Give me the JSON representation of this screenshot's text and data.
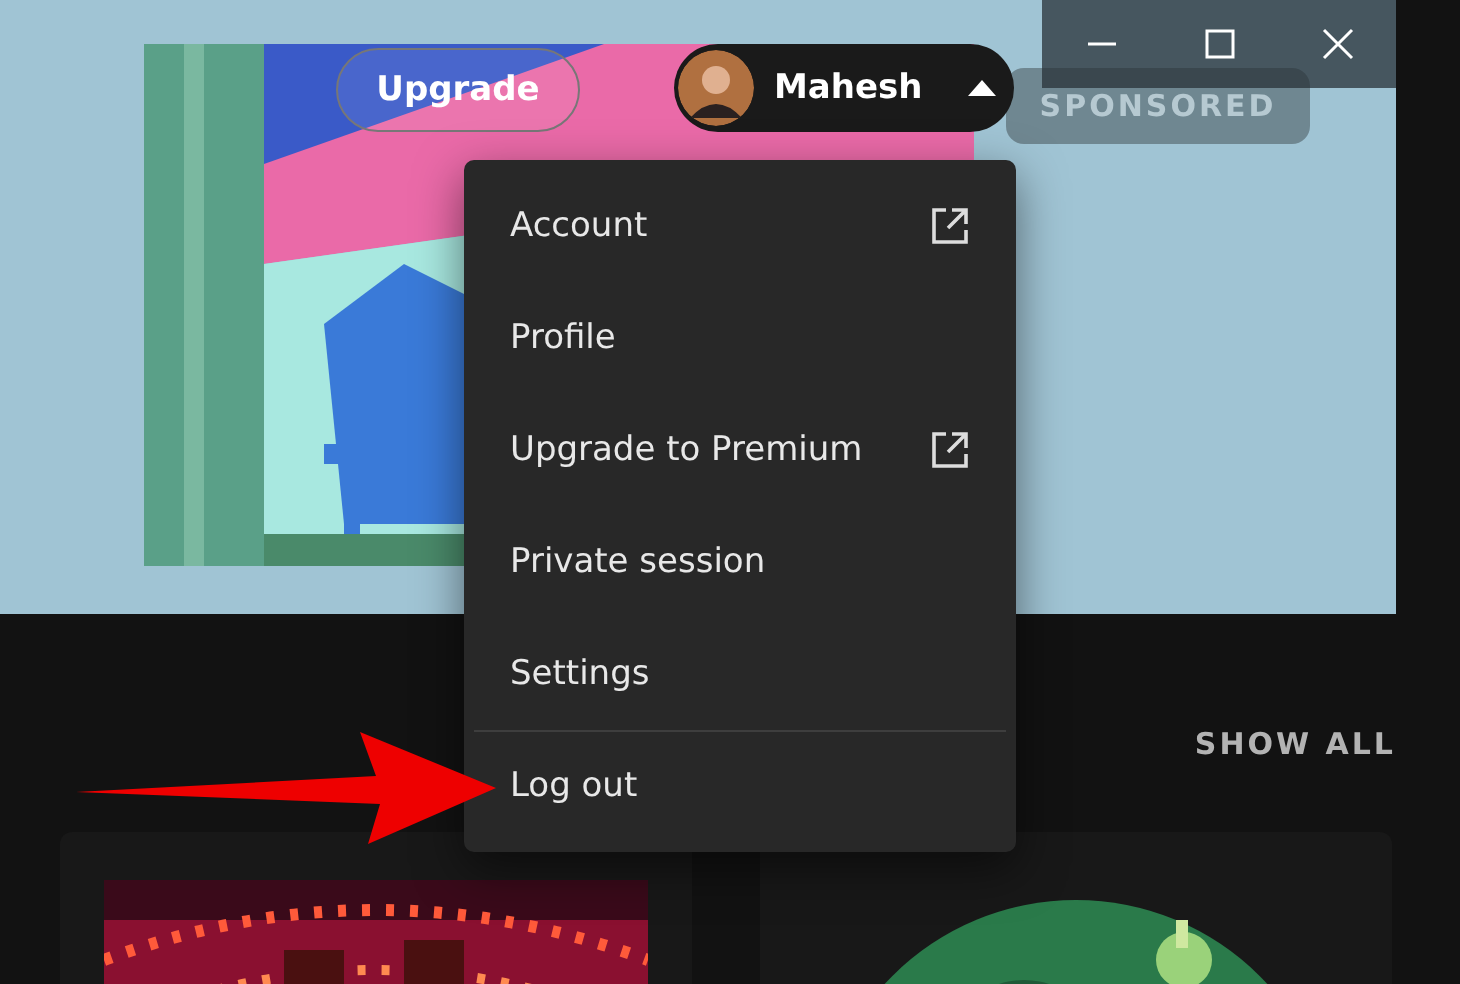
{
  "header": {
    "upgrade_button": "Upgrade",
    "user": {
      "name": "Mahesh",
      "menu_open": true
    },
    "ad_badge": "SPONSORED"
  },
  "menu": [
    {
      "label": "Account",
      "external": true,
      "separated": false
    },
    {
      "label": "Profile",
      "external": false,
      "separated": false
    },
    {
      "label": "Upgrade to Premium",
      "external": true,
      "separated": false
    },
    {
      "label": "Private session",
      "external": false,
      "separated": false
    },
    {
      "label": "Settings",
      "external": false,
      "separated": false
    },
    {
      "label": "Log out",
      "external": false,
      "separated": true
    }
  ],
  "section": {
    "show_all": "SHOW ALL"
  }
}
